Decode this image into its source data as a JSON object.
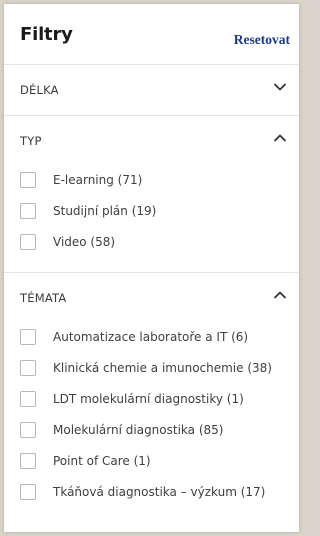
{
  "header": {
    "title": "Filtry",
    "reset_label": "Resetovat"
  },
  "sections": [
    {
      "title": "DÉLKA",
      "expanded": false,
      "chevron": "chevron-down-icon",
      "items": []
    },
    {
      "title": "TYP",
      "expanded": true,
      "chevron": "chevron-up-icon",
      "items": [
        {
          "label": "E-learning (71)",
          "checked": false
        },
        {
          "label": "Studijní plán (19)",
          "checked": false
        },
        {
          "label": "Video (58)",
          "checked": false
        }
      ]
    },
    {
      "title": "TÉMATA",
      "expanded": true,
      "chevron": "chevron-up-icon",
      "items": [
        {
          "label": "Automatizace laboratoře a IT (6)",
          "checked": false
        },
        {
          "label": "Klinická chemie a imunochemie (38)",
          "checked": false
        },
        {
          "label": "LDT molekulární diagnostiky (1)",
          "checked": false
        },
        {
          "label": "Molekulární diagnostika (85)",
          "checked": false
        },
        {
          "label": "Point of Care (1)",
          "checked": false
        },
        {
          "label": "Tkáňová diagnostika – výzkum (17)",
          "checked": false
        }
      ]
    }
  ],
  "colors": {
    "accent_link": "#1b3a8c",
    "text": "#3f3f3f",
    "divider": "#e4e4e4"
  }
}
